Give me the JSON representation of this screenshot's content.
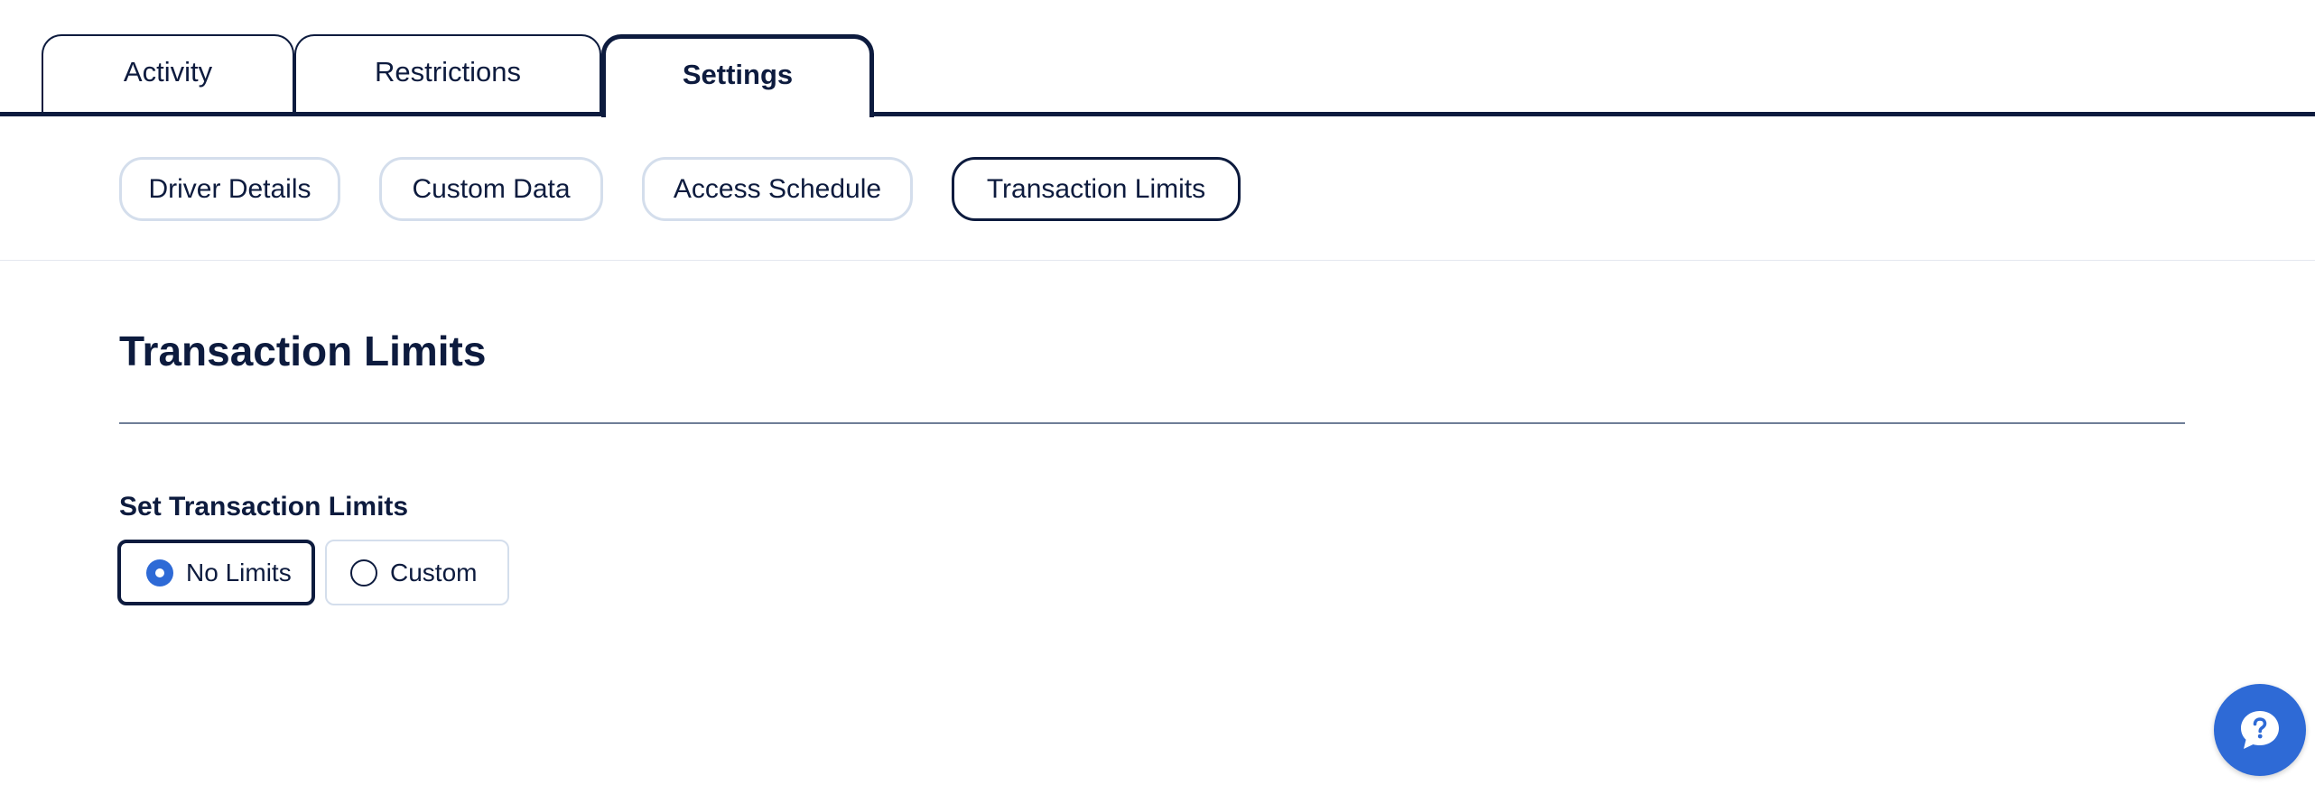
{
  "tabs": [
    {
      "label": "Activity",
      "active": false
    },
    {
      "label": "Restrictions",
      "active": false
    },
    {
      "label": "Settings",
      "active": true
    }
  ],
  "subnav": [
    {
      "label": "Driver Details",
      "active": false
    },
    {
      "label": "Custom Data",
      "active": false
    },
    {
      "label": "Access Schedule",
      "active": false
    },
    {
      "label": "Transaction Limits",
      "active": true
    }
  ],
  "section": {
    "title": "Transaction Limits",
    "field_label": "Set Transaction Limits",
    "options": [
      {
        "label": "No Limits",
        "selected": true
      },
      {
        "label": "Custom",
        "selected": false
      }
    ]
  },
  "help": {
    "icon": "help-chat-icon"
  },
  "colors": {
    "navy": "#0d1b3e",
    "accent": "#2e6ad6",
    "pill_border": "#d4deec"
  }
}
